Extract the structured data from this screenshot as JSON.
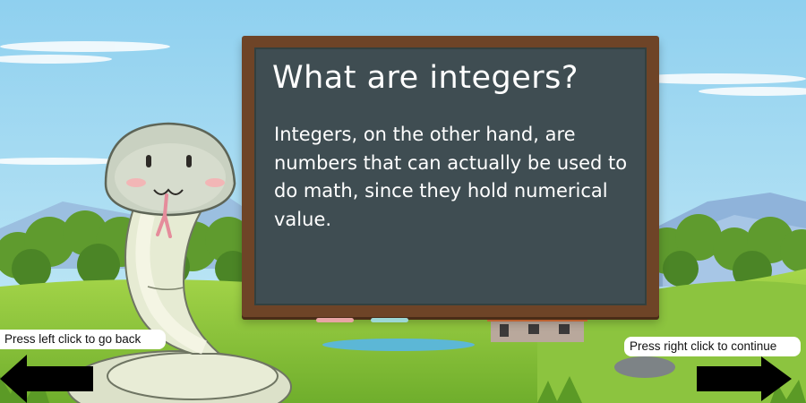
{
  "lesson": {
    "title": "What are integers?",
    "body": "Integers, on the other hand, are numbers that can actually be used to do math, since they hold numerical value."
  },
  "navigation": {
    "back_hint": "Press left click to go back",
    "continue_hint": "Press right click to continue"
  },
  "colors": {
    "sky": "#a9dbf2",
    "board_frame": "#6e4427",
    "board_surface": "#3f4d52",
    "chalk_text": "#ffffff",
    "chalk_pink": "#e8a4a4",
    "chalk_cyan": "#9cd7d5",
    "arrow": "#000000"
  },
  "icons": {
    "mascot": "snake-icon",
    "back": "arrow-left-icon",
    "continue": "arrow-right-icon"
  }
}
